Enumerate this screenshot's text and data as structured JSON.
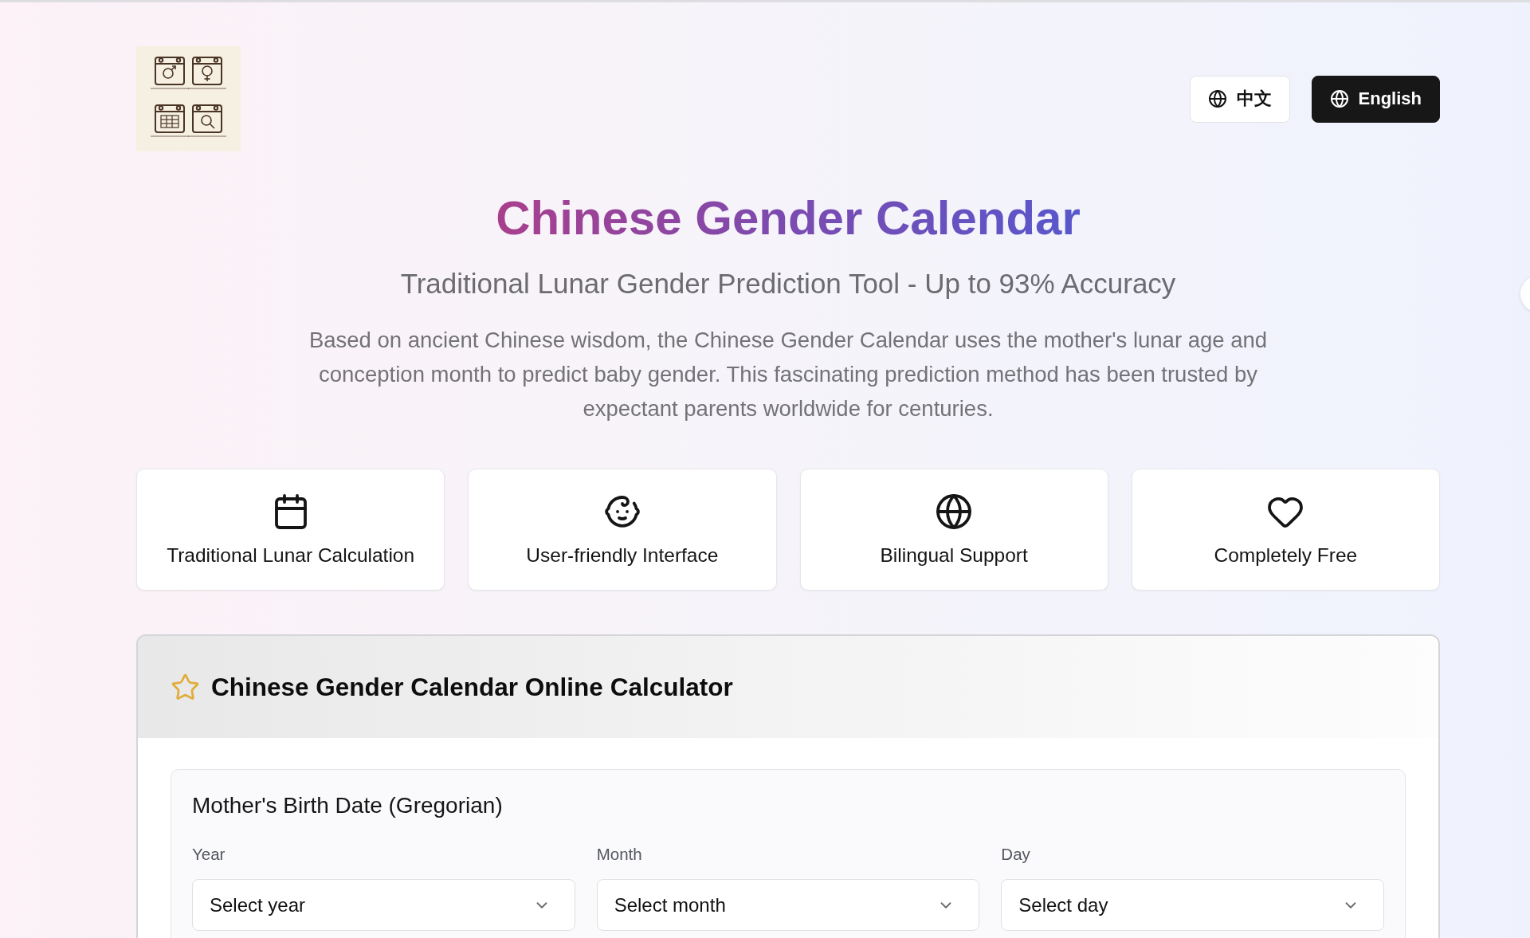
{
  "language_buttons": [
    {
      "label": "中文",
      "selected": false
    },
    {
      "label": "English",
      "selected": true
    }
  ],
  "hero": {
    "title": "Chinese Gender Calendar",
    "subtitle": "Traditional Lunar Gender Prediction Tool - Up to 93% Accuracy",
    "description": "Based on ancient Chinese wisdom, the Chinese Gender Calendar uses the mother's lunar age and conception month to predict baby gender. This fascinating prediction method has been trusted by expectant parents worldwide for centuries."
  },
  "features": [
    {
      "label": "Traditional Lunar Calculation"
    },
    {
      "label": "User-friendly Interface"
    },
    {
      "label": "Bilingual Support"
    },
    {
      "label": "Completely Free"
    }
  ],
  "calculator": {
    "title": "Chinese Gender Calendar Online Calculator",
    "sections": [
      {
        "title": "Mother's Birth Date (Gregorian)",
        "fields": [
          {
            "label": "Year",
            "placeholder": "Select year"
          },
          {
            "label": "Month",
            "placeholder": "Select month"
          },
          {
            "label": "Day",
            "placeholder": "Select day"
          }
        ]
      }
    ]
  }
}
